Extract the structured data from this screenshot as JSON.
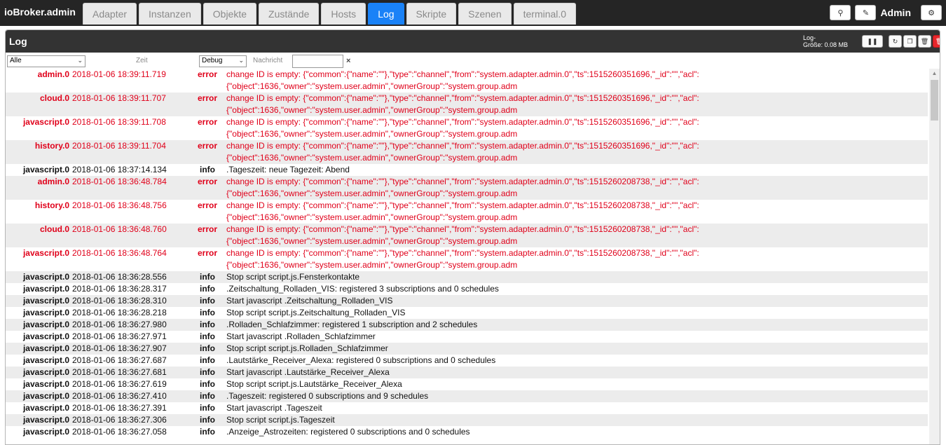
{
  "app": {
    "brand": "ioBroker.admin",
    "user": "Admin"
  },
  "tabs": [
    {
      "label": "Adapter"
    },
    {
      "label": "Instanzen"
    },
    {
      "label": "Objekte"
    },
    {
      "label": "Zustände"
    },
    {
      "label": "Hosts"
    },
    {
      "label": "Log",
      "active": true
    },
    {
      "label": "Skripte"
    },
    {
      "label": "Szenen"
    },
    {
      "label": "terminal.0"
    }
  ],
  "topbar": {
    "search_icon": "search-icon",
    "edit_icon": "edit-icon",
    "settings_icon": "gear-icon"
  },
  "panel": {
    "title": "Log",
    "log_size_label": "Log-",
    "log_size_label2": "Größe:",
    "log_size_value": "0.08 MB"
  },
  "filters": {
    "source_value": "Alle",
    "time_label": "Zeit",
    "level_value": "Debug",
    "message_label": "Nachricht",
    "message_value": "",
    "clear": "×"
  },
  "colors": {
    "accent": "#1a82f7",
    "error": "#e0001a",
    "header": "#333333",
    "danger": "#e8262b"
  },
  "log": [
    {
      "src": "admin.0",
      "ts": "2018-01-06 18:39:11.719",
      "sev": "error",
      "msg": "change ID is empty: {\"common\":{\"name\":\"\"},\"type\":\"channel\",\"from\":\"system.adapter.admin.0\",\"ts\":1515260351696,\"_id\":\"\",\"acl\":",
      "msg2": "{\"object\":1636,\"owner\":\"system.user.admin\",\"ownerGroup\":\"system.group.adm"
    },
    {
      "src": "cloud.0",
      "ts": "2018-01-06 18:39:11.707",
      "sev": "error",
      "msg": "change ID is empty: {\"common\":{\"name\":\"\"},\"type\":\"channel\",\"from\":\"system.adapter.admin.0\",\"ts\":1515260351696,\"_id\":\"\",\"acl\":",
      "msg2": "{\"object\":1636,\"owner\":\"system.user.admin\",\"ownerGroup\":\"system.group.adm"
    },
    {
      "src": "javascript.0",
      "ts": "2018-01-06 18:39:11.708",
      "sev": "error",
      "msg": "change ID is empty: {\"common\":{\"name\":\"\"},\"type\":\"channel\",\"from\":\"system.adapter.admin.0\",\"ts\":1515260351696,\"_id\":\"\",\"acl\":",
      "msg2": "{\"object\":1636,\"owner\":\"system.user.admin\",\"ownerGroup\":\"system.group.adm"
    },
    {
      "src": "history.0",
      "ts": "2018-01-06 18:39:11.704",
      "sev": "error",
      "msg": "change ID is empty: {\"common\":{\"name\":\"\"},\"type\":\"channel\",\"from\":\"system.adapter.admin.0\",\"ts\":1515260351696,\"_id\":\"\",\"acl\":",
      "msg2": "{\"object\":1636,\"owner\":\"system.user.admin\",\"ownerGroup\":\"system.group.adm"
    },
    {
      "src": "javascript.0",
      "ts": "2018-01-06 18:37:14.134",
      "sev": "info",
      "msg": ".Tageszeit: neue Tagezeit: Abend"
    },
    {
      "src": "admin.0",
      "ts": "2018-01-06 18:36:48.784",
      "sev": "error",
      "msg": "change ID is empty: {\"common\":{\"name\":\"\"},\"type\":\"channel\",\"from\":\"system.adapter.admin.0\",\"ts\":1515260208738,\"_id\":\"\",\"acl\":",
      "msg2": "{\"object\":1636,\"owner\":\"system.user.admin\",\"ownerGroup\":\"system.group.adm"
    },
    {
      "src": "history.0",
      "ts": "2018-01-06 18:36:48.756",
      "sev": "error",
      "msg": "change ID is empty: {\"common\":{\"name\":\"\"},\"type\":\"channel\",\"from\":\"system.adapter.admin.0\",\"ts\":1515260208738,\"_id\":\"\",\"acl\":",
      "msg2": "{\"object\":1636,\"owner\":\"system.user.admin\",\"ownerGroup\":\"system.group.adm"
    },
    {
      "src": "cloud.0",
      "ts": "2018-01-06 18:36:48.760",
      "sev": "error",
      "msg": "change ID is empty: {\"common\":{\"name\":\"\"},\"type\":\"channel\",\"from\":\"system.adapter.admin.0\",\"ts\":1515260208738,\"_id\":\"\",\"acl\":",
      "msg2": "{\"object\":1636,\"owner\":\"system.user.admin\",\"ownerGroup\":\"system.group.adm"
    },
    {
      "src": "javascript.0",
      "ts": "2018-01-06 18:36:48.764",
      "sev": "error",
      "msg": "change ID is empty: {\"common\":{\"name\":\"\"},\"type\":\"channel\",\"from\":\"system.adapter.admin.0\",\"ts\":1515260208738,\"_id\":\"\",\"acl\":",
      "msg2": "{\"object\":1636,\"owner\":\"system.user.admin\",\"ownerGroup\":\"system.group.adm"
    },
    {
      "src": "javascript.0",
      "ts": "2018-01-06 18:36:28.556",
      "sev": "info",
      "msg": "Stop script script.js.Fensterkontakte"
    },
    {
      "src": "javascript.0",
      "ts": "2018-01-06 18:36:28.317",
      "sev": "info",
      "msg": ".Zeitschaltung_Rolladen_VIS: registered 3 subscriptions and 0 schedules"
    },
    {
      "src": "javascript.0",
      "ts": "2018-01-06 18:36:28.310",
      "sev": "info",
      "msg": "Start javascript .Zeitschaltung_Rolladen_VIS"
    },
    {
      "src": "javascript.0",
      "ts": "2018-01-06 18:36:28.218",
      "sev": "info",
      "msg": "Stop script script.js.Zeitschaltung_Rolladen_VIS"
    },
    {
      "src": "javascript.0",
      "ts": "2018-01-06 18:36:27.980",
      "sev": "info",
      "msg": ".Rolladen_Schlafzimmer: registered 1 subscription and 2 schedules"
    },
    {
      "src": "javascript.0",
      "ts": "2018-01-06 18:36:27.971",
      "sev": "info",
      "msg": "Start javascript .Rolladen_Schlafzimmer"
    },
    {
      "src": "javascript.0",
      "ts": "2018-01-06 18:36:27.907",
      "sev": "info",
      "msg": "Stop script script.js.Rolladen_Schlafzimmer"
    },
    {
      "src": "javascript.0",
      "ts": "2018-01-06 18:36:27.687",
      "sev": "info",
      "msg": ".Lautstärke_Receiver_Alexa: registered 0 subscriptions and 0 schedules"
    },
    {
      "src": "javascript.0",
      "ts": "2018-01-06 18:36:27.681",
      "sev": "info",
      "msg": "Start javascript .Lautstärke_Receiver_Alexa"
    },
    {
      "src": "javascript.0",
      "ts": "2018-01-06 18:36:27.619",
      "sev": "info",
      "msg": "Stop script script.js.Lautstärke_Receiver_Alexa"
    },
    {
      "src": "javascript.0",
      "ts": "2018-01-06 18:36:27.410",
      "sev": "info",
      "msg": ".Tageszeit: registered 0 subscriptions and 9 schedules"
    },
    {
      "src": "javascript.0",
      "ts": "2018-01-06 18:36:27.391",
      "sev": "info",
      "msg": "Start javascript .Tageszeit"
    },
    {
      "src": "javascript.0",
      "ts": "2018-01-06 18:36:27.306",
      "sev": "info",
      "msg": "Stop script script.js.Tageszeit"
    },
    {
      "src": "javascript.0",
      "ts": "2018-01-06 18:36:27.058",
      "sev": "info",
      "msg": ".Anzeige_Astrozeiten: registered 0 subscriptions and 0 schedules"
    }
  ]
}
